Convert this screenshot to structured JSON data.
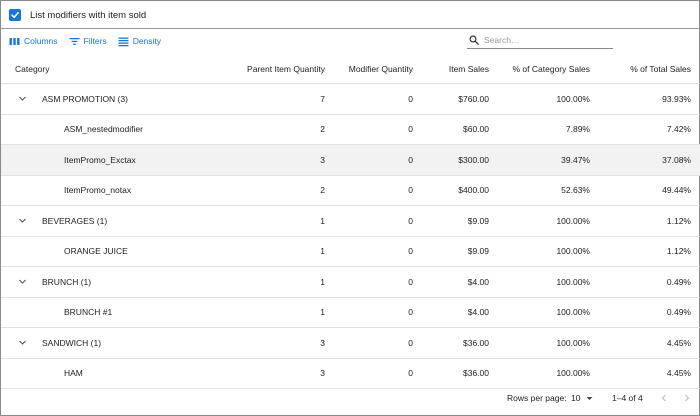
{
  "topbar": {
    "checkbox_label": "List modifiers with item sold",
    "checked": true
  },
  "toolbar": {
    "columns_label": "Columns",
    "filters_label": "Filters",
    "density_label": "Density",
    "search_placeholder": "Search…",
    "accent_color": "#1976d2"
  },
  "table": {
    "headers": [
      "Category",
      "Parent Item Quantity",
      "Modifier Quantity",
      "Item Sales",
      "% of Category Sales",
      "% of Total Sales"
    ],
    "rows": [
      {
        "name": "ASM PROMOTION (3)",
        "group": true,
        "parent_qty": "7",
        "modifier_qty": "0",
        "sales": "$760.00",
        "cat_pct": "100.00%",
        "total_pct": "93.93%"
      },
      {
        "name": "ASM_nestedmodifier",
        "group": false,
        "parent_qty": "2",
        "modifier_qty": "0",
        "sales": "$60.00",
        "cat_pct": "7.89%",
        "total_pct": "7.42%"
      },
      {
        "name": "ItemPromo_Exctax",
        "group": false,
        "parent_qty": "3",
        "modifier_qty": "0",
        "sales": "$300.00",
        "cat_pct": "39.47%",
        "total_pct": "37.08%"
      },
      {
        "name": "ItemPromo_notax",
        "group": false,
        "parent_qty": "2",
        "modifier_qty": "0",
        "sales": "$400.00",
        "cat_pct": "52.63%",
        "total_pct": "49.44%"
      },
      {
        "name": "BEVERAGES (1)",
        "group": true,
        "parent_qty": "1",
        "modifier_qty": "0",
        "sales": "$9.09",
        "cat_pct": "100.00%",
        "total_pct": "1.12%"
      },
      {
        "name": "ORANGE JUICE",
        "group": false,
        "parent_qty": "1",
        "modifier_qty": "0",
        "sales": "$9.09",
        "cat_pct": "100.00%",
        "total_pct": "1.12%"
      },
      {
        "name": "BRUNCH (1)",
        "group": true,
        "parent_qty": "1",
        "modifier_qty": "0",
        "sales": "$4.00",
        "cat_pct": "100.00%",
        "total_pct": "0.49%"
      },
      {
        "name": "BRUNCH #1",
        "group": false,
        "parent_qty": "1",
        "modifier_qty": "0",
        "sales": "$4.00",
        "cat_pct": "100.00%",
        "total_pct": "0.49%"
      },
      {
        "name": "SANDWICH (1)",
        "group": true,
        "parent_qty": "3",
        "modifier_qty": "0",
        "sales": "$36.00",
        "cat_pct": "100.00%",
        "total_pct": "4.45%"
      },
      {
        "name": "HAM",
        "group": false,
        "parent_qty": "3",
        "modifier_qty": "0",
        "sales": "$36.00",
        "cat_pct": "100.00%",
        "total_pct": "4.45%"
      }
    ]
  },
  "footer": {
    "rows_per_page_label": "Rows per page:",
    "rows_per_page_value": "10",
    "range_label": "1–4 of 4"
  }
}
